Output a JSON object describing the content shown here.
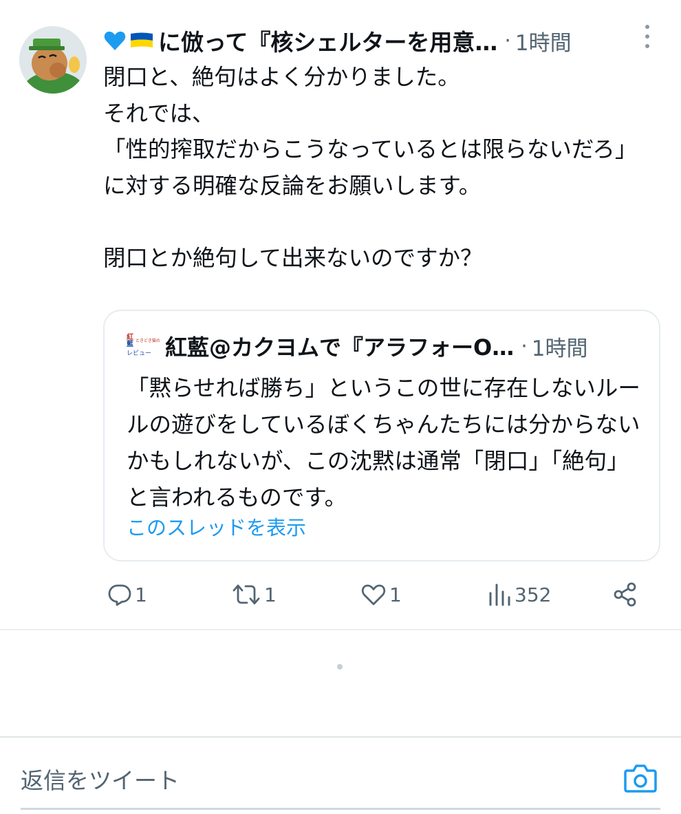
{
  "tweet": {
    "author_name": "に倣って『核シェルターを用意…",
    "separator": "·",
    "time": "1時間",
    "text": "閉口と、絶句はよく分かりました。\nそれでは、\n「性的搾取だからこうなっているとは限らないだろ」\nに対する明確な反論をお願いします。\n\n閉口とか絶句して出来ないのですか？"
  },
  "quoted_tweet": {
    "author_name": "紅藍@カクヨムで『アラフォーO…",
    "separator": "·",
    "time": "1時間",
    "text": "「黙らせれば勝ち」というこの世に存在しないルールの遊びをしているぼくちゃんたちには分からないかもしれないが、この沈黙は通常「閉口」「絶句」と言われるものです。",
    "show_thread": "このスレッドを表示",
    "avatar_text": {
      "top": "紅",
      "bottom": "藍",
      "small": "ときどき猫の",
      "label": "レビュー"
    }
  },
  "actions": {
    "reply_count": "1",
    "retweet_count": "1",
    "like_count": "1",
    "view_count": "352"
  },
  "reply_box": {
    "placeholder": "返信をツイート"
  },
  "colors": {
    "link": "#1d9bf0",
    "secondary_text": "#536471",
    "heart": "#1d9bf0",
    "flag_top": "#0057b7",
    "flag_bottom": "#ffd700"
  }
}
